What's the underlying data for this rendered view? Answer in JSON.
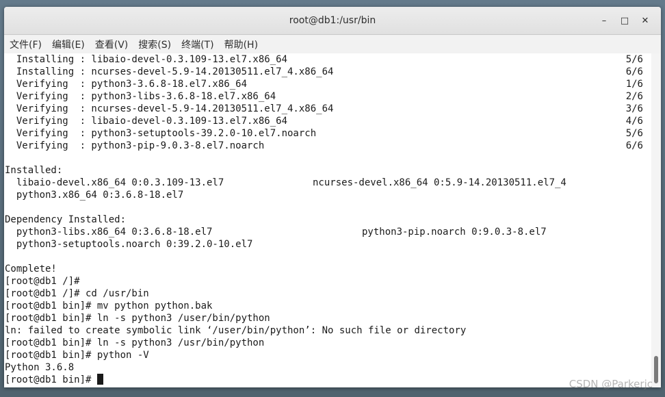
{
  "window": {
    "title": "root@db1:/usr/bin",
    "minimize_glyph": "–",
    "maximize_glyph": "□",
    "close_glyph": "✕"
  },
  "menu": {
    "items": [
      "文件(F)",
      "编辑(E)",
      "查看(V)",
      "搜索(S)",
      "终端(T)",
      "帮助(H)"
    ]
  },
  "terminal": {
    "transactions": [
      {
        "text": "  Installing : libaio-devel-0.3.109-13.el7.x86_64",
        "count": "5/6"
      },
      {
        "text": "  Installing : ncurses-devel-5.9-14.20130511.el7_4.x86_64",
        "count": "6/6"
      },
      {
        "text": "  Verifying  : python3-3.6.8-18.el7.x86_64",
        "count": "1/6"
      },
      {
        "text": "  Verifying  : python3-libs-3.6.8-18.el7.x86_64",
        "count": "2/6"
      },
      {
        "text": "  Verifying  : ncurses-devel-5.9-14.20130511.el7_4.x86_64",
        "count": "3/6"
      },
      {
        "text": "  Verifying  : libaio-devel-0.3.109-13.el7.x86_64",
        "count": "4/6"
      },
      {
        "text": "  Verifying  : python3-setuptools-39.2.0-10.el7.noarch",
        "count": "5/6"
      },
      {
        "text": "  Verifying  : python3-pip-9.0.3-8.el7.noarch",
        "count": "6/6"
      }
    ],
    "installed_header": "Installed:",
    "installed_row1_a": "  libaio-devel.x86_64 0:0.3.109-13.el7",
    "installed_row1_b": "ncurses-devel.x86_64 0:5.9-14.20130511.el7_4",
    "installed_row2": "  python3.x86_64 0:3.6.8-18.el7",
    "dep_header": "Dependency Installed:",
    "dep_row1_a": "  python3-libs.x86_64 0:3.6.8-18.el7",
    "dep_row1_b": "python3-pip.noarch 0:9.0.3-8.el7",
    "dep_row2": "  python3-setuptools.noarch 0:39.2.0-10.el7",
    "complete": "Complete!",
    "session": [
      "[root@db1 /]# ",
      "[root@db1 /]# cd /usr/bin",
      "[root@db1 bin]# mv python python.bak",
      "[root@db1 bin]# ln -s python3 /user/bin/python",
      "ln: failed to create symbolic link ‘/user/bin/python’: No such file or directory",
      "[root@db1 bin]# ln -s python3 /usr/bin/python",
      "[root@db1 bin]# python -V",
      "Python 3.6.8"
    ],
    "prompt": "[root@db1 bin]# "
  },
  "watermark": "CSDN @Parkerjc"
}
